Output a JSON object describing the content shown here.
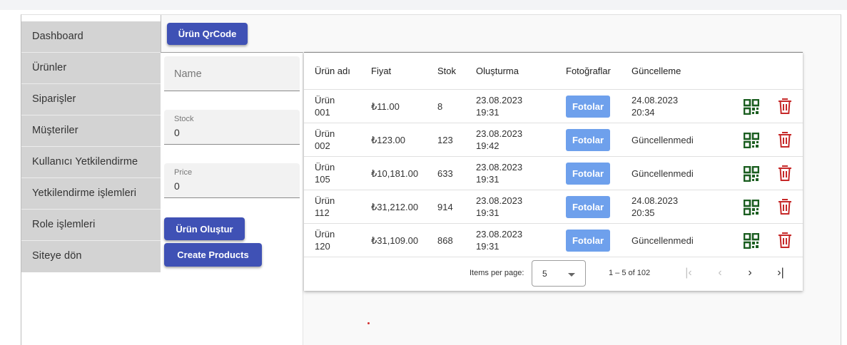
{
  "sidebar": {
    "items": [
      {
        "label": "Dashboard"
      },
      {
        "label": "Ürünler"
      },
      {
        "label": "Siparişler"
      },
      {
        "label": "Müşteriler"
      },
      {
        "label": "Kullanıcı Yetkilendirme"
      },
      {
        "label": "Yetkilendirme işlemleri"
      },
      {
        "label": "Role işlemleri"
      },
      {
        "label": "Siteye dön"
      }
    ]
  },
  "toolbar": {
    "qr_label": "Ürün QrCode"
  },
  "form": {
    "name_placeholder": "Name",
    "stock_label": "Stock",
    "stock_value": "0",
    "price_label": "Price",
    "price_value": "0",
    "create_tr_label": "Ürün Oluştur",
    "create_en_label": "Create Products"
  },
  "table": {
    "headers": [
      "Ürün adı",
      "Fiyat",
      "Stok",
      "Oluşturma",
      "Fotoğraflar",
      "Güncelleme"
    ],
    "rows": [
      {
        "name_l1": "Ürün",
        "name_l2": "001",
        "price": "₺11.00",
        "stock": "8",
        "created_l1": "23.08.2023",
        "created_l2": "19:31",
        "photos": "Fotolar",
        "updated_l1": "24.08.2023",
        "updated_l2": "20:34"
      },
      {
        "name_l1": "Ürün",
        "name_l2": "002",
        "price": "₺123.00",
        "stock": "123",
        "created_l1": "23.08.2023",
        "created_l2": "19:42",
        "photos": "Fotolar",
        "updated_l1": "Güncellenmedi",
        "updated_l2": ""
      },
      {
        "name_l1": "Ürün",
        "name_l2": "105",
        "price": "₺10,181.00",
        "stock": "633",
        "created_l1": "23.08.2023",
        "created_l2": "19:31",
        "photos": "Fotolar",
        "updated_l1": "Güncellenmedi",
        "updated_l2": ""
      },
      {
        "name_l1": "Ürün",
        "name_l2": "112",
        "price": "₺31,212.00",
        "stock": "914",
        "created_l1": "23.08.2023",
        "created_l2": "19:31",
        "photos": "Fotolar",
        "updated_l1": "24.08.2023",
        "updated_l2": "20:35"
      },
      {
        "name_l1": "Ürün",
        "name_l2": "120",
        "price": "₺31,109.00",
        "stock": "868",
        "created_l1": "23.08.2023",
        "created_l2": "19:31",
        "photos": "Fotolar",
        "updated_l1": "Güncellenmedi",
        "updated_l2": ""
      }
    ],
    "qr_icon_color": "#1b5e20",
    "delete_icon_color": "#c62828"
  },
  "paginator": {
    "items_per_page_label": "Items per page:",
    "page_size": "5",
    "range_label": "1 – 5 of 102",
    "first_icon": "first-page-icon",
    "prev_icon": "chevron-left-icon",
    "next_icon": "chevron-right-icon",
    "last_icon": "last-page-icon"
  },
  "colors": {
    "primary": "#3f51b5",
    "photo_button": "#6ea0ec",
    "sidebar_bg": "#d3d3d3"
  }
}
